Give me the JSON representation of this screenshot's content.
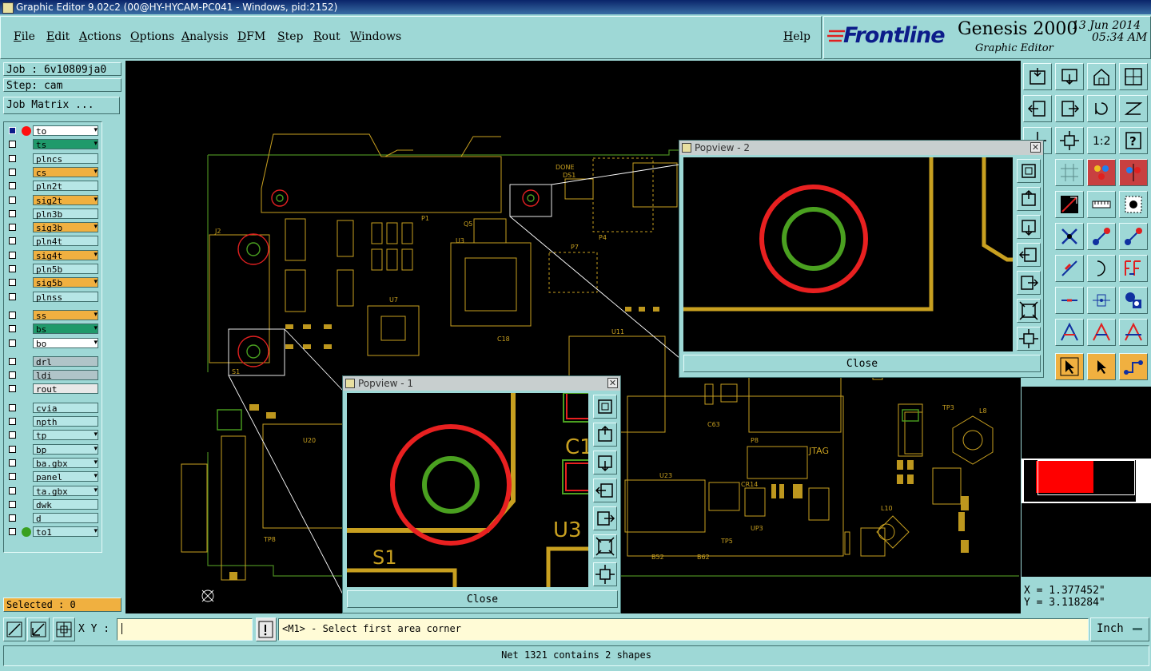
{
  "window": {
    "title": "Graphic Editor 9.02c2 (00@HY-HYCAM-PC041 - Windows, pid:2152)"
  },
  "menu": {
    "file": "File",
    "edit": "Edit",
    "actions": "Actions",
    "options": "Options",
    "analysis": "Analysis",
    "dfm": "DFM",
    "step": "Step",
    "rout": "Rout",
    "windows": "Windows",
    "help": "Help"
  },
  "brand": {
    "logo": "Frontline",
    "product": "Genesis 2000",
    "subtitle": "Graphic Editor",
    "date": "13 Jun 2014",
    "time": "05:34 AM"
  },
  "job": {
    "job_label": "Job : 6v10809ja0",
    "step_label": "Step: cam",
    "matrix_button": "Job Matrix ..."
  },
  "layers": [
    {
      "name": "to",
      "color": "#ffffff"
    },
    {
      "name": "ts",
      "color": "#1f9a6b"
    },
    {
      "name": "plncs",
      "color": "#b6e6e6"
    },
    {
      "name": "cs",
      "color": "#f0b040"
    },
    {
      "name": "pln2t",
      "color": "#b6e6e6"
    },
    {
      "name": "sig2t",
      "color": "#f0b040"
    },
    {
      "name": "pln3b",
      "color": "#b6e6e6"
    },
    {
      "name": "sig3b",
      "color": "#f0b040"
    },
    {
      "name": "pln4t",
      "color": "#b6e6e6"
    },
    {
      "name": "sig4t",
      "color": "#f0b040"
    },
    {
      "name": "pln5b",
      "color": "#b6e6e6"
    },
    {
      "name": "sig5b",
      "color": "#f0b040"
    },
    {
      "name": "plnss",
      "color": "#b6e6e6"
    },
    {
      "name": "ss",
      "color": "#f0b040"
    },
    {
      "name": "bs",
      "color": "#1f9a6b"
    },
    {
      "name": "bo",
      "color": "#ffffff"
    },
    {
      "name": "drl",
      "color": "#b0c4c8"
    },
    {
      "name": "ldi",
      "color": "#b0c4c8"
    },
    {
      "name": "rout",
      "color": "#e8e8e8"
    },
    {
      "name": "cvia",
      "color": "#b6e6e6"
    },
    {
      "name": "npth",
      "color": "#b6e6e6"
    },
    {
      "name": "tp",
      "color": "#b6e6e6"
    },
    {
      "name": "bp",
      "color": "#b6e6e6"
    },
    {
      "name": "ba.gbx",
      "color": "#b6e6e6"
    },
    {
      "name": "panel",
      "color": "#b6e6e6"
    },
    {
      "name": "ta.gbx",
      "color": "#b6e6e6"
    },
    {
      "name": "dwk",
      "color": "#b6e6e6"
    },
    {
      "name": "d",
      "color": "#b6e6e6"
    },
    {
      "name": "to1",
      "color": "#b6e6e6"
    }
  ],
  "selected": "Selected : 0",
  "board_labels": {
    "done": "DONE",
    "ds1": "DS1",
    "jtag": "JTAG",
    "u3": "U3",
    "u7": "U7",
    "u11": "U11",
    "u20": "U20",
    "u23": "U23",
    "p1": "P1",
    "p4": "P4",
    "p7": "P7",
    "p8": "P8",
    "j2": "J2",
    "s1": "S1",
    "q5": "Q5",
    "c18": "C18",
    "c63": "C63",
    "tp5": "TP5",
    "tp8": "TP8",
    "b52": "B52",
    "b62": "B62",
    "up3": "UP3",
    "cr14": "CR14",
    "tp3": "TP3",
    "l8": "L8",
    "l10": "L10"
  },
  "popup2": {
    "title": "Popview - 2",
    "close": "Close",
    "x": "✕"
  },
  "popup1": {
    "title": "Popview - 1",
    "close": "Close",
    "x": "✕",
    "labels": {
      "c1": "C1",
      "u3": "U3",
      "s1": "S1"
    }
  },
  "coords": {
    "x": "X = 1.377452\"",
    "y": "Y = 3.118284\""
  },
  "bottom": {
    "xy_label": "X Y :",
    "xy_value": "",
    "prompt": "<M1> - Select first area corner",
    "unit": "Inch",
    "status": "Net 1321 contains 2 shapes"
  },
  "colors": {
    "panel": "#9ed8d6",
    "canvas": "#000000",
    "trace": "#c8a020",
    "pad": "#e02020",
    "green": "#4aa020"
  }
}
